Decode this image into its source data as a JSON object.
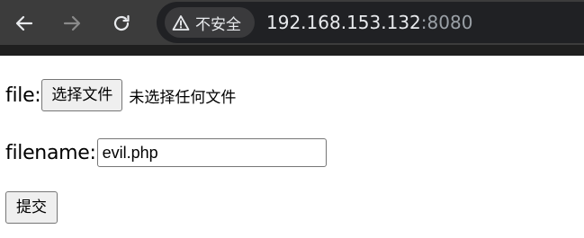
{
  "browser": {
    "security_label": "不安全",
    "url_host": "192.168.153.132",
    "url_port": ":8080"
  },
  "form": {
    "file_label": "file:",
    "choose_file_button": "选择文件",
    "no_file_text": "未选择任何文件",
    "filename_label": "filename:",
    "filename_value": "evil.php",
    "submit_label": "提交"
  },
  "colors": {
    "toolbar_bg": "#3c3c3c",
    "omnibox_bg": "#202124",
    "chip_bg": "#3a3a3c",
    "url_text": "#e8eaed",
    "url_port": "#9aa0a6"
  }
}
